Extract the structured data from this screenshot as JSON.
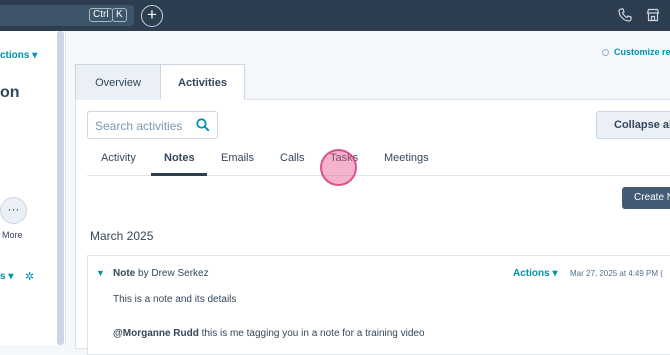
{
  "topbar": {
    "shortcut_ctrl": "Ctrl",
    "shortcut_k": "K",
    "add_label": "+",
    "phone_icon": "phone-icon",
    "marketplace_icon": "marketplace-icon"
  },
  "left_panel": {
    "actions_label": "ctions",
    "record_title": "on",
    "more_label": "More",
    "more_glyph": "···",
    "bottom_label": "s"
  },
  "header": {
    "customize_label": "Customize re"
  },
  "tabs": {
    "overview": "Overview",
    "activities": "Activities"
  },
  "search": {
    "placeholder": "Search activities"
  },
  "collapse_label": "Collapse all",
  "subtabs": [
    "Activity",
    "Notes",
    "Emails",
    "Calls",
    "Tasks",
    "Meetings"
  ],
  "create_label": "Create N",
  "month_label": "March 2025",
  "note": {
    "type": "Note",
    "by": "by Drew Serkez",
    "actions_label": "Actions",
    "date": "Mar 27, 2025 at 4:49 PM (",
    "body": "This is a note and its details",
    "mention": "@Morganne Rudd",
    "mention_text": " this is me tagging you in a note for a training video"
  },
  "colors": {
    "accent": "#0091ae",
    "topbar": "#2d3e50",
    "click_marker": "#e7548f"
  }
}
